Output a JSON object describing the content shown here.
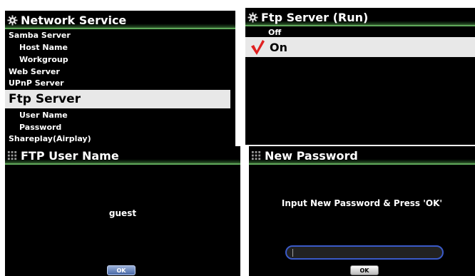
{
  "network_service": {
    "title": "Network Service",
    "items": [
      {
        "label": "Samba Server"
      },
      {
        "label": "Host Name"
      },
      {
        "label": "Workgroup"
      },
      {
        "label": "Web Server"
      },
      {
        "label": "UPnP Server"
      },
      {
        "label": "Ftp Server"
      },
      {
        "label": "User Name"
      },
      {
        "label": "Password"
      },
      {
        "label": "Shareplay(Airplay)"
      }
    ]
  },
  "ftp_server": {
    "title": "Ftp Server (Run)",
    "options": [
      {
        "label": "Off"
      },
      {
        "label": "On"
      }
    ],
    "selected": "On"
  },
  "ftp_user_name": {
    "title": "FTP User Name",
    "value": "guest",
    "ok_label": "OK"
  },
  "new_password": {
    "title": "New Password",
    "prompt": "Input New Password & Press 'OK'",
    "value": "",
    "ok_label": "OK"
  },
  "icons": {
    "gear": "gear-icon",
    "grid": "grid-icon",
    "check": "checkmark-icon"
  },
  "colors": {
    "title_accent": "#5fa85a",
    "selected_bg": "#e8e8e8",
    "check_red": "#e02020",
    "ok_button_blue": "#4a6aa8",
    "field_border_blue": "#3a5ac8"
  }
}
